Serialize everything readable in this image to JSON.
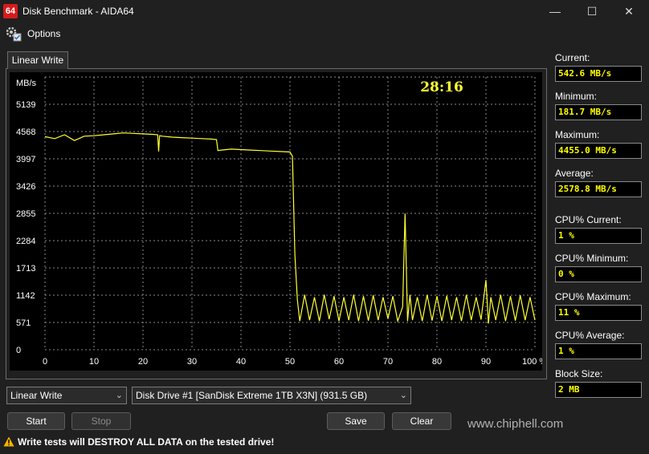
{
  "window": {
    "icon_text": "64",
    "title": "Disk Benchmark - AIDA64",
    "minimize": "—",
    "maximize": "☐",
    "close": "✕"
  },
  "menu": {
    "options_label": "Options"
  },
  "tabs": [
    {
      "label": "Linear Write"
    }
  ],
  "chart_data": {
    "type": "line",
    "ylabel": "MB/s",
    "timer": "28:16",
    "y_ticks": [
      "5139",
      "4568",
      "3997",
      "3426",
      "2855",
      "2284",
      "1713",
      "1142",
      "571",
      "0"
    ],
    "x_ticks": [
      "0",
      "10",
      "20",
      "30",
      "40",
      "50",
      "60",
      "70",
      "80",
      "90",
      "100 %"
    ],
    "ylim": [
      0,
      5710
    ],
    "xlim": [
      0,
      100
    ],
    "grid": true,
    "series_color": "#ffff33",
    "series": [
      {
        "x": [
          0,
          2,
          4,
          6,
          8,
          10,
          12,
          14,
          16,
          18,
          20,
          22,
          23,
          23.2,
          23.4,
          24,
          26,
          28,
          30,
          32,
          34,
          35,
          35.3,
          36,
          38,
          40,
          42,
          44,
          46,
          48,
          50,
          50.5,
          51,
          51.5,
          52,
          53,
          54,
          55,
          56,
          57,
          58,
          59,
          60,
          61,
          62,
          63,
          64,
          65,
          66,
          67,
          68,
          69,
          70,
          71,
          72,
          73,
          73.5,
          74,
          74.5,
          75,
          76,
          77,
          78,
          79,
          80,
          81,
          82,
          83,
          84,
          85,
          86,
          87,
          88,
          89,
          90,
          90.5,
          91,
          92,
          93,
          94,
          95,
          96,
          97,
          98,
          99,
          100
        ],
        "y": [
          4460,
          4420,
          4500,
          4380,
          4470,
          4480,
          4500,
          4520,
          4540,
          4530,
          4520,
          4510,
          4500,
          4150,
          4480,
          4470,
          4450,
          4440,
          4430,
          4420,
          4410,
          4400,
          4170,
          4180,
          4200,
          4190,
          4180,
          4170,
          4160,
          4150,
          4140,
          4050,
          2000,
          1050,
          600,
          1150,
          620,
          1100,
          600,
          1150,
          640,
          1120,
          600,
          1100,
          620,
          1150,
          600,
          1120,
          610,
          1140,
          620,
          1100,
          650,
          1120,
          600,
          900,
          2850,
          600,
          1150,
          620,
          1100,
          600,
          1150,
          610,
          1120,
          600,
          1130,
          620,
          1100,
          600,
          1150,
          620,
          1100,
          630,
          1460,
          550,
          1100,
          620,
          1150,
          600,
          1120,
          610,
          1140,
          620,
          1100,
          620
        ]
      }
    ]
  },
  "stats": {
    "current_label": "Current:",
    "current_value": "542.6 MB/s",
    "minimum_label": "Minimum:",
    "minimum_value": "181.7 MB/s",
    "maximum_label": "Maximum:",
    "maximum_value": "4455.0 MB/s",
    "average_label": "Average:",
    "average_value": "2578.8 MB/s",
    "cpu_current_label": "CPU% Current:",
    "cpu_current_value": "1 %",
    "cpu_minimum_label": "CPU% Minimum:",
    "cpu_minimum_value": "0 %",
    "cpu_maximum_label": "CPU% Maximum:",
    "cpu_maximum_value": "11 %",
    "cpu_average_label": "CPU% Average:",
    "cpu_average_value": "1 %",
    "block_size_label": "Block Size:",
    "block_size_value": "2 MB"
  },
  "controls": {
    "test_select": "Linear Write",
    "drive_select": "Disk Drive #1  [SanDisk Extreme 1TB X3N]  (931.5 GB)",
    "start_label": "Start",
    "stop_label": "Stop",
    "save_label": "Save",
    "clear_label": "Clear"
  },
  "status": {
    "warning": "Write tests will DESTROY ALL DATA on the tested drive!"
  },
  "watermark": "www.chiphell.com"
}
